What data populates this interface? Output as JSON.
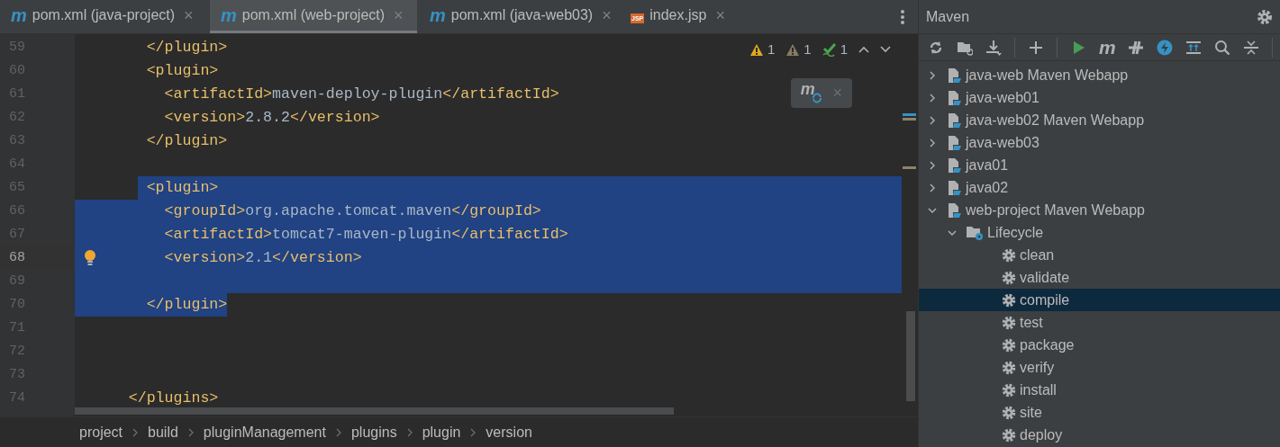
{
  "tabs": [
    {
      "kind": "maven",
      "icon_text": "m",
      "label": "pom.xml (java-project)",
      "close": "×",
      "selected": false
    },
    {
      "kind": "maven",
      "icon_text": "m",
      "label": "pom.xml (web-project)",
      "close": "×",
      "selected": true
    },
    {
      "kind": "maven",
      "icon_text": "m",
      "label": "pom.xml (java-web03)",
      "close": "×",
      "selected": false
    },
    {
      "kind": "jsp",
      "icon_text": "JSP",
      "label": "index.jsp",
      "close": "×",
      "selected": false
    }
  ],
  "inspections": [
    {
      "kind": "warning",
      "count": "1"
    },
    {
      "kind": "weak_warning",
      "count": "1"
    },
    {
      "kind": "typo",
      "count": "1"
    }
  ],
  "maven_reload_popup": {
    "icon_text": "m",
    "close": "×"
  },
  "editor_lines": [
    {
      "kind": "inner",
      "number": "59",
      "current": false,
      "bulb": false,
      "selected": false,
      "segments": [
        {
          "kind": "tag",
          "text": "</plugin>"
        }
      ]
    },
    {
      "kind": "inner",
      "number": "60",
      "current": false,
      "bulb": false,
      "selected": false,
      "segments": [
        {
          "kind": "tag",
          "text": "<plugin>"
        }
      ],
      "children": [
        {
          "number": "61",
          "current": false,
          "bulb": false,
          "selected": false,
          "segments": [
            {
              "kind": "tag",
              "text": "<artifactId>"
            },
            {
              "kind": "text",
              "text": "maven-deploy-plugin"
            },
            {
              "kind": "tag",
              "text": "</artifactId>"
            }
          ]
        },
        {
          "number": "62",
          "current": false,
          "bulb": false,
          "selected": false,
          "segments": [
            {
              "kind": "tag",
              "text": "<version>"
            },
            {
              "kind": "text",
              "text": "2.8.2"
            },
            {
              "kind": "tag",
              "text": "</version>"
            }
          ]
        }
      ]
    },
    {
      "kind": "inner",
      "number": "63",
      "current": false,
      "bulb": false,
      "selected": false,
      "segments": [
        {
          "kind": "tag",
          "text": "</plugin>"
        }
      ]
    },
    {
      "number": "64",
      "current": false,
      "bulb": false,
      "selected": false
    },
    {
      "kind": "inner",
      "number": "65",
      "current": false,
      "bulb": false,
      "selected": true,
      "selection_start": true,
      "selection_end": false,
      "segments": [
        {
          "kind": "tag",
          "text": "<plugin>"
        }
      ],
      "children": [
        {
          "number": "66",
          "current": false,
          "bulb": false,
          "selected": true,
          "selection_start": false,
          "selection_end": false,
          "segments": [
            {
              "kind": "tag",
              "text": "<groupId>"
            },
            {
              "kind": "text",
              "text": "org.apache.tomcat.maven"
            },
            {
              "kind": "tag",
              "text": "</groupId>"
            }
          ]
        },
        {
          "number": "67",
          "current": false,
          "bulb": false,
          "selected": true,
          "selection_start": false,
          "selection_end": false,
          "segments": [
            {
              "kind": "tag",
              "text": "<artifactId>"
            },
            {
              "kind": "text",
              "text": "tomcat7-maven-plugin"
            },
            {
              "kind": "tag",
              "text": "</artifactId>"
            }
          ]
        },
        {
          "number": "68",
          "current": true,
          "bulb": true,
          "selected": true,
          "selection_start": false,
          "selection_end": false,
          "segments": [
            {
              "kind": "tag",
              "text": "<version>"
            },
            {
              "kind": "text",
              "text": "2.1"
            },
            {
              "kind": "tag",
              "text": "</version>"
            }
          ]
        },
        {
          "number": "69",
          "current": false,
          "bulb": false,
          "selected": true
        }
      ]
    },
    {
      "kind": "inner",
      "number": "70",
      "current": false,
      "bulb": false,
      "selected": true,
      "selection_start": false,
      "selection_end": true,
      "segments": [
        {
          "kind": "tag",
          "text": "</plugin>"
        }
      ]
    },
    {
      "number": "71",
      "current": false,
      "bulb": false,
      "selected": false
    },
    {
      "number": "72",
      "current": false,
      "bulb": false,
      "selected": false
    },
    {
      "number": "73",
      "current": false,
      "bulb": false,
      "selected": false
    },
    {
      "kind": "outer",
      "number": "74",
      "current": false,
      "bulb": false,
      "selected": false,
      "segments": [
        {
          "kind": "tag",
          "text": "</plugins>"
        }
      ]
    }
  ],
  "breadcrumbs": [
    "project",
    "build",
    "pluginManagement",
    "plugins",
    "plugin",
    "version"
  ],
  "maven": {
    "title": "Maven",
    "toolbar": [
      {
        "kind": "reload"
      },
      {
        "kind": "folder"
      },
      {
        "kind": "download"
      },
      {
        "kind": "separator"
      },
      {
        "kind": "add"
      },
      {
        "kind": "separator"
      },
      {
        "kind": "run"
      },
      {
        "kind": "maven",
        "icon_text": "m"
      },
      {
        "kind": "toggle"
      },
      {
        "kind": "offline"
      },
      {
        "kind": "show"
      },
      {
        "kind": "search"
      },
      {
        "kind": "collapse"
      },
      {
        "kind": "separator"
      }
    ],
    "tree": [
      {
        "kind": "module",
        "label": "java-web Maven Webapp",
        "expanded": false,
        "selected": false
      },
      {
        "kind": "module",
        "label": "java-web01",
        "expanded": false,
        "selected": false
      },
      {
        "kind": "module",
        "label": "java-web02 Maven Webapp",
        "expanded": false,
        "selected": false
      },
      {
        "kind": "module",
        "label": "java-web03",
        "expanded": false,
        "selected": false
      },
      {
        "kind": "module",
        "label": "java01",
        "expanded": false,
        "selected": false
      },
      {
        "kind": "module",
        "label": "java02",
        "expanded": false,
        "selected": false
      },
      {
        "kind": "module",
        "label": "web-project Maven Webapp",
        "expanded": true,
        "selected": false,
        "children": [
          {
            "kind": "lifecycle",
            "label": "Lifecycle",
            "expanded": true,
            "selected": false,
            "children": [
              {
                "kind": "phase",
                "label": "clean",
                "selected": false
              },
              {
                "kind": "phase",
                "label": "validate",
                "selected": false
              },
              {
                "kind": "phase",
                "label": "compile",
                "selected": true
              },
              {
                "kind": "phase",
                "label": "test",
                "selected": false
              },
              {
                "kind": "phase",
                "label": "package",
                "selected": false
              },
              {
                "kind": "phase",
                "label": "verify",
                "selected": false
              },
              {
                "kind": "phase",
                "label": "install",
                "selected": false
              },
              {
                "kind": "phase",
                "label": "site",
                "selected": false
              },
              {
                "kind": "phase",
                "label": "deploy",
                "selected": false
              }
            ]
          }
        ]
      }
    ]
  }
}
